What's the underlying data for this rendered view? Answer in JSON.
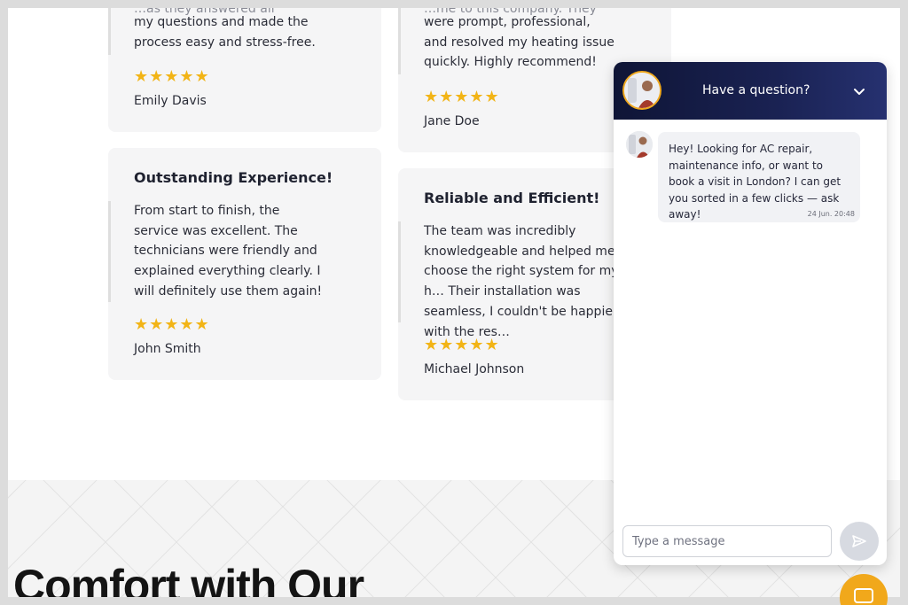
{
  "reviews": [
    {
      "title": "",
      "text": "my questions and made the process easy and stress-free.",
      "partial_text": "…as they answered all",
      "stars": "★★★★★",
      "rating": 5,
      "author": "Emily Davis"
    },
    {
      "title": "",
      "text": "were prompt, professional, and resolved my heating issue quickly. Highly recommend!",
      "partial_text": "…me to this company. They",
      "stars": "★★★★★",
      "rating": 5,
      "author": "Jane Doe"
    },
    {
      "title": "Outstanding Experience!",
      "text": "From start to finish, the service was excellent. The technicians were friendly and explained everything clearly. I will definitely use them again!",
      "stars": "★★★★★",
      "rating": 5,
      "author": "John Smith"
    },
    {
      "title": "Reliable and Efficient!",
      "text": "The team was incredibly knowledgeable and helped me choose the right system for my h… Their installation was seamless, I couldn't be happier with the res…",
      "stars": "★★★★★",
      "rating": 5,
      "author": "Michael Johnson"
    }
  ],
  "section": {
    "heading": "Comfort with Our"
  },
  "chat": {
    "title": "Have a question?",
    "message": "Hey! Looking for AC repair, maintenance info, or want to book a visit in London? I can get you sorted in a few clicks — ask away!",
    "time": "24 Jun. 20:48",
    "input_placeholder": "Type a message"
  },
  "colors": {
    "accent": "#f1a81b",
    "star": "#f2b416",
    "chat_header": "#1a2253",
    "card_bg": "#f5f5f6"
  },
  "icons": {
    "collapse": "chevron-down-icon",
    "send": "send-icon",
    "launcher": "chat-launcher-icon"
  }
}
